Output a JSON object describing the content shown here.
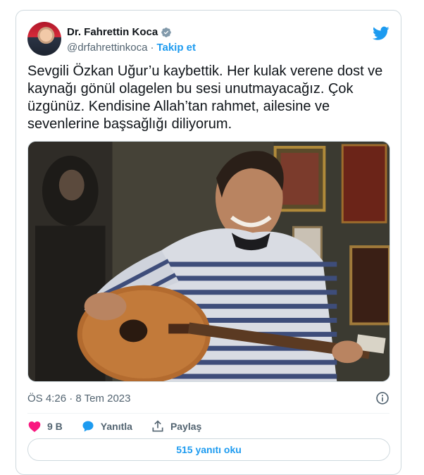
{
  "author": {
    "name": "Dr. Fahrettin Koca",
    "handle": "@drfahrettinkoca",
    "separator": "·",
    "follow_label": "Takip et"
  },
  "tweet": {
    "text": "Sevgili Özkan Uğur’u kaybettik. Her kulak verene dost ve\nkaynağı gönül olagelen bu sesi unutmayacağız. Çok\nüzgünüz. Kendisine Allah’tan rahmet, ailesine ve\nsevenlerine başsağlığı diliyorum.",
    "timestamp": "ÖS 4:26 · 8 Tem 2023"
  },
  "actions": {
    "like_count": "9 B",
    "reply_label": "Yanıtla",
    "share_label": "Paylaş"
  },
  "replies_button_label": "515 yanıtı oku",
  "colors": {
    "accent": "#1d9bf0",
    "like": "#f91880",
    "secondary_text": "#536471",
    "border": "#cfd9de"
  },
  "icons": [
    "verified-badge-icon",
    "twitter-bird-icon",
    "info-icon",
    "heart-icon",
    "reply-bubble-icon",
    "share-icon"
  ]
}
